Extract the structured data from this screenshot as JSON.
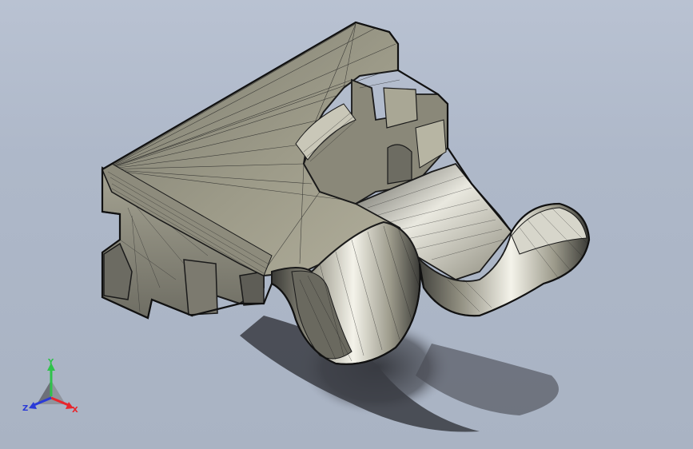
{
  "viewport": {
    "background_top": "#b9c2d2",
    "background_bottom": "#a9b3c3"
  },
  "model": {
    "face_color": "#9a9886",
    "shadow_color": "#3b3d43",
    "highlight_color": "#f2f2ea",
    "edge_color": "#1a1a1a"
  },
  "triad": {
    "x_label": "X",
    "y_label": "Y",
    "z_label": "Z",
    "x_color": "#e8262c",
    "y_color": "#2fc24b",
    "z_color": "#2a3ad8"
  }
}
